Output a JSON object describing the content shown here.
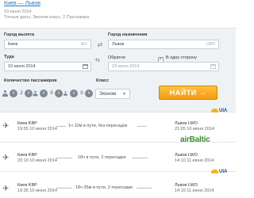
{
  "header": {
    "route": "Киев — Львов",
    "line1": "10 июня 2014",
    "line2": "Точные даты, Эконом класс, 2 Пассажира"
  },
  "form": {
    "from_label": "Город вылета",
    "from_value": "Киев",
    "from_code": "IEV",
    "to_label": "Город назначения",
    "to_value": "Львов",
    "to_code": "LWO",
    "depart_label": "Туда",
    "depart_value": "10 июня 2014",
    "return_label": "Обратно",
    "return_placeholder": "24 июня 2014",
    "one_way_label": "В одну сторону",
    "one_way_checked": true,
    "passengers_label": "Количество пассажиров",
    "adults": "2",
    "children": "0",
    "infants": "0",
    "class_label": "Класс",
    "class_value": "Эконом",
    "search_label": "НАЙТИ →"
  },
  "results": [
    {
      "airline": "UIA",
      "from": "Киев KBP",
      "depart": "19:55 10 июня 2014",
      "duration": "1ч 10м в пути, без пересадок",
      "to": "Львов LWO",
      "arrive": "21:05 10 июня 2014"
    },
    {
      "airline": "airBaltic",
      "from": "Киев KBP",
      "depart": "20:10 10 июня 2014",
      "duration": "18ч в пути, 2 пересадки",
      "to": "Львов LWO",
      "arrive": "14:10 11 июня 2014"
    },
    {
      "airline": "UIA",
      "from": "Киев KBP",
      "depart": "19:35 10 июня 2014",
      "duration": "18ч 35м в пути, 2 пересадки",
      "to": "Львов LWO",
      "arrive": "14:10 11 июня 2014"
    }
  ]
}
